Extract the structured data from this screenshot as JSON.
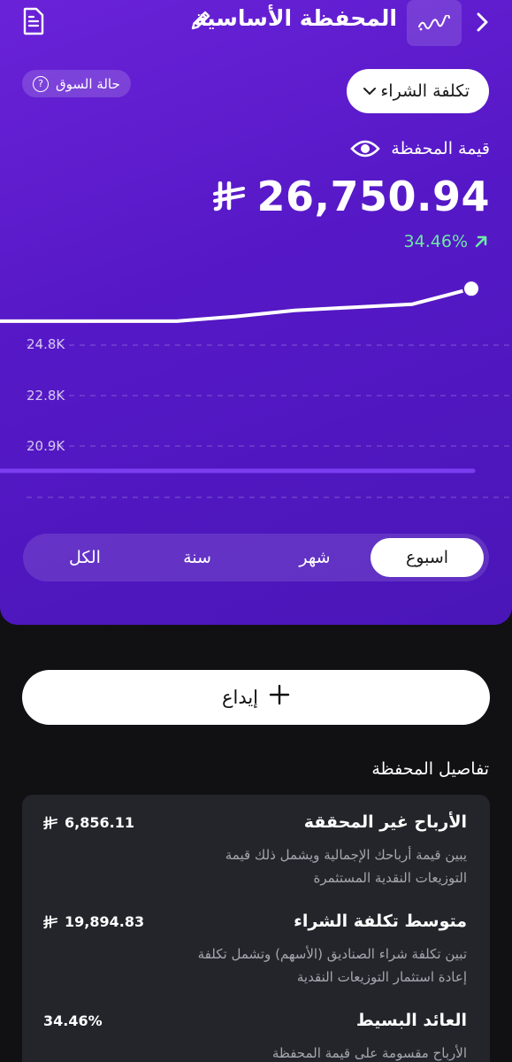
{
  "header": {
    "title": "المحفظة الأساسية",
    "back_icon": "chevron-right-icon",
    "logo_icon": "squiggle-logo-icon",
    "edit_icon": "pencil-icon",
    "doc_icon": "document-icon"
  },
  "market_status": {
    "label": "حالة السوق",
    "icon": "question-icon"
  },
  "cost_selector": {
    "value": "تكلفة الشراء",
    "icon": "chevron-down-icon"
  },
  "portfolio": {
    "value_label": "قيمة المحفظة",
    "visibility_icon": "eye-icon",
    "currency_symbol": "⃁",
    "amount": "26,750.94",
    "change": "34.46%",
    "change_icon": "arrow-up-right-icon"
  },
  "chart_data": {
    "type": "line",
    "y_ticks": [
      "24.8K",
      "22.8K",
      "20.9K"
    ],
    "series": [
      {
        "values": [
          25700,
          25700,
          25700,
          25700,
          25850,
          26050,
          26150,
          26250,
          26750.94
        ]
      }
    ]
  },
  "periods": {
    "tabs": [
      "اسبوع",
      "شهر",
      "سنة",
      "الكل"
    ],
    "active": "اسبوع"
  },
  "deposit": {
    "label": "إيداع",
    "icon": "plus-icon"
  },
  "details": {
    "title": "تفاصيل المحفظة",
    "rows": [
      {
        "title": "الأرباح غير المحققة",
        "desc": "يبين قيمة أرباحك الإجمالية ويشمل ذلك قيمة التوزيعات النقدية المستثمرة",
        "value": "6,856.11",
        "currency": "⃁"
      },
      {
        "title": "متوسط تكلفة الشراء",
        "desc": "تبين تكلفة شراء الصناديق (الأسهم) وتشمل تكلفة إعادة استثمار التوزيعات النقدية",
        "value": "19,894.83",
        "currency": "⃁"
      },
      {
        "title": "العائد البسيط",
        "desc": "الأرباح مقسومة على قيمة المحفظة",
        "value": "34.46%"
      }
    ]
  }
}
